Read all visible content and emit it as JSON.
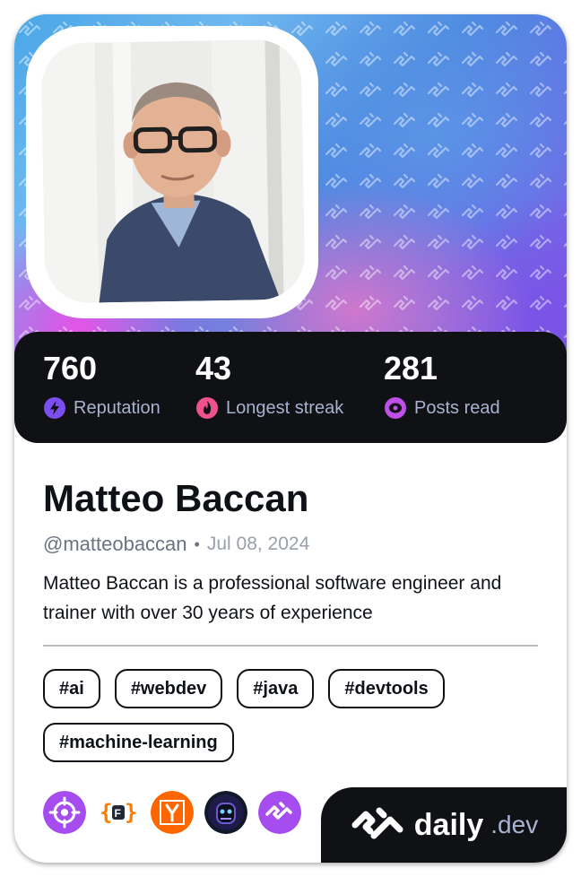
{
  "stats": [
    {
      "value": "760",
      "label": "Reputation",
      "icon": "lightning-icon",
      "color": "#7b4ef0"
    },
    {
      "value": "43",
      "label": "Longest streak",
      "icon": "flame-icon",
      "color": "#f0528f"
    },
    {
      "value": "281",
      "label": "Posts read",
      "icon": "eye-icon",
      "color": "#c04ee8"
    }
  ],
  "profile": {
    "name": "Matteo Baccan",
    "handle": "@matteobaccan",
    "separator": "•",
    "date": "Jul 08, 2024",
    "bio": "Matteo Baccan is a professional software engineer and trainer with over 30 years of experience"
  },
  "tags": [
    "#ai",
    "#webdev",
    "#java",
    "#devtools",
    "#machine-learning"
  ],
  "sources": [
    {
      "icon": "target-icon",
      "color": "#a64df0"
    },
    {
      "icon": "curly-brackets-icon",
      "color": "#ff7a00"
    },
    {
      "icon": "ycombinator-icon",
      "color": "#ff6600"
    },
    {
      "icon": "robot-head-icon",
      "color": "#111827"
    },
    {
      "icon": "dailydev-icon",
      "color": "#a64df0"
    }
  ],
  "brand": {
    "word": "daily",
    "suffix": ".dev"
  }
}
